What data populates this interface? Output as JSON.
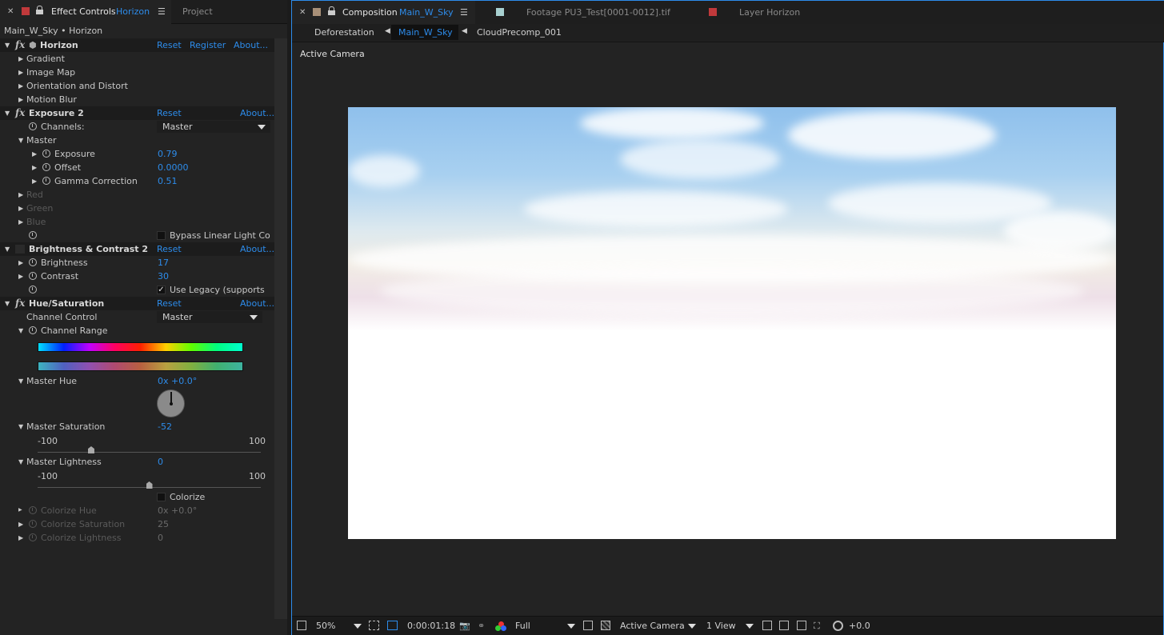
{
  "left_panel": {
    "tab_effect_controls": "Effect Controls",
    "tab_effect_controls_layer": "Horizon",
    "tab_project": "Project",
    "breadcrumb": "Main_W_Sky • Horizon",
    "horizon": {
      "name": "Horizon",
      "reset": "Reset",
      "register": "Register",
      "about": "About...",
      "groups": [
        "Gradient",
        "Image Map",
        "Orientation and Distort",
        "Motion Blur"
      ]
    },
    "exposure": {
      "name": "Exposure 2",
      "reset": "Reset",
      "about": "About...",
      "channels_label": "Channels:",
      "channels_value": "Master",
      "master_label": "Master",
      "exposure_label": "Exposure",
      "exposure_value": "0.79",
      "offset_label": "Offset",
      "offset_value": "0.0000",
      "gamma_label": "Gamma Correction",
      "gamma_value": "0.51",
      "red": "Red",
      "green": "Green",
      "blue": "Blue",
      "bypass_label": "Bypass Linear Light Co"
    },
    "brightness": {
      "name": "Brightness & Contrast 2",
      "reset": "Reset",
      "about": "About...",
      "brightness_label": "Brightness",
      "brightness_value": "17",
      "contrast_label": "Contrast",
      "contrast_value": "30",
      "legacy_label": "Use Legacy (supports",
      "legacy_checked": "✓"
    },
    "huesat": {
      "name": "Hue/Saturation",
      "reset": "Reset",
      "about": "About...",
      "channel_control_label": "Channel Control",
      "channel_control_value": "Master",
      "channel_range_label": "Channel Range",
      "master_hue_label": "Master Hue",
      "master_hue_value": "0x +0.0°",
      "master_sat_label": "Master Saturation",
      "master_sat_value": "-52",
      "master_sat_min": "-100",
      "master_sat_max": "100",
      "master_sat_level": -52,
      "master_light_label": "Master Lightness",
      "master_light_value": "0",
      "master_light_min": "-100",
      "master_light_max": "100",
      "master_light_level": 0,
      "colorize_label": "Colorize",
      "colorize_hue_label": "Colorize Hue",
      "colorize_hue_value": "0x +0.0°",
      "colorize_sat_label": "Colorize Saturation",
      "colorize_sat_value": "25",
      "colorize_light_label": "Colorize Lightness",
      "colorize_light_value": "0"
    }
  },
  "right_panel": {
    "tab_composition": "Composition",
    "tab_composition_name": "Main_W_Sky",
    "tab_footage": "Footage  PU3_Test[0001-0012].tif",
    "tab_layer": "Layer  Horizon",
    "flow": [
      "Deforestation",
      "Main_W_Sky",
      "CloudPrecomp_001"
    ],
    "active_camera_label": "Active Camera",
    "bottom": {
      "zoom": "50%",
      "timecode": "0:00:01:18",
      "resolution": "Full",
      "view": "Active Camera",
      "layout": "1 View",
      "exposure": "+0.0"
    }
  },
  "colors": {
    "accent": "#2d8ceb",
    "effect_controls_swatch": "#c0393b",
    "composition_swatch": "#a89078",
    "footage_swatch": "#a8d0d0",
    "layer_swatch": "#c0393b"
  }
}
